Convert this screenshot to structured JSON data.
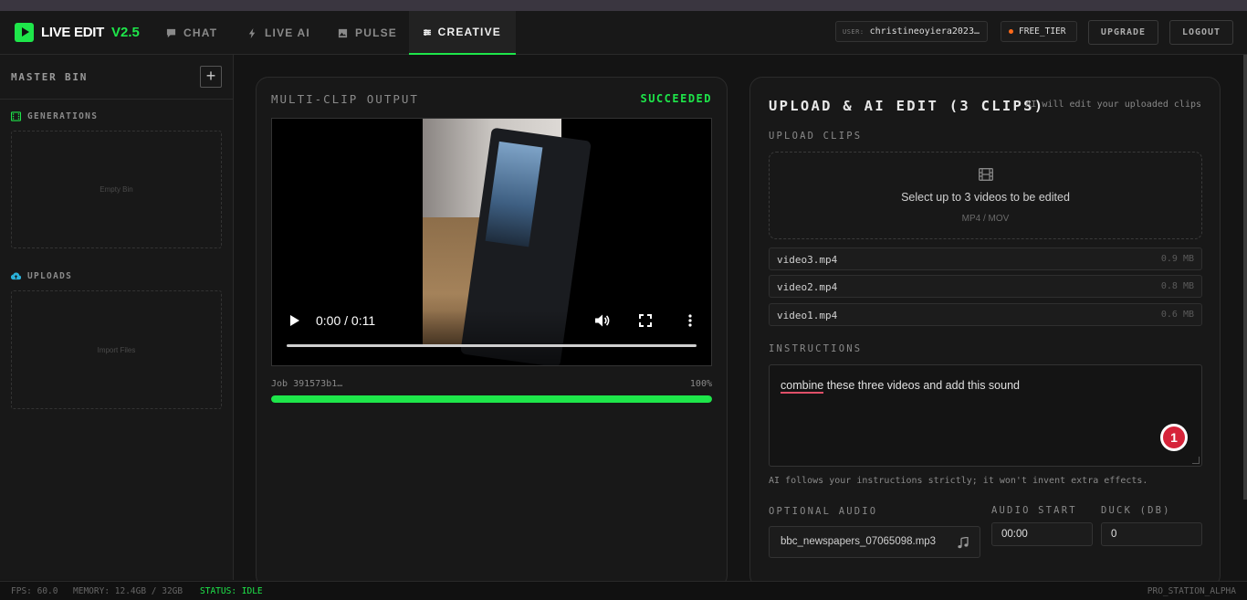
{
  "app": {
    "name": "LIVE EDIT",
    "version": "V2.5"
  },
  "nav": {
    "tabs": [
      {
        "label": "CHAT",
        "icon": "chat-icon"
      },
      {
        "label": "LIVE AI",
        "icon": "bolt-icon"
      },
      {
        "label": "PULSE",
        "icon": "image-icon"
      },
      {
        "label": "CREATIVE",
        "icon": "sliders-icon",
        "active": true
      }
    ],
    "user_label": "USER:",
    "user_value": "christineoyiera2023…",
    "tier": "FREE_TIER",
    "upgrade": "UPGRADE",
    "logout": "LOGOUT",
    "accent": "#1ee64a",
    "tier_dot": "#ff6a1a"
  },
  "sidebar": {
    "title": "MASTER BIN",
    "add": "+",
    "sections": [
      {
        "label": "GENERATIONS",
        "icon": "film-icon",
        "empty": "Empty Bin"
      },
      {
        "label": "UPLOADS",
        "icon": "cloud-upload-icon",
        "empty": "Import Files"
      }
    ]
  },
  "output": {
    "title": "MULTI-CLIP OUTPUT",
    "status": "SUCCEEDED",
    "time": "0:00 / 0:11",
    "job": "Job 391573b1…",
    "percent": "100%",
    "progress": 1.0
  },
  "upload": {
    "title": "UPLOAD & AI EDIT (3 CLIPS)",
    "note": "AI will edit your uploaded clips",
    "upload_label": "UPLOAD CLIPS",
    "dropzone_main": "Select up to 3 videos to be edited",
    "dropzone_sub": "MP4 / MOV",
    "files": [
      {
        "name": "video3.mp4",
        "size": "0.9 MB"
      },
      {
        "name": "video2.mp4",
        "size": "0.8 MB"
      },
      {
        "name": "video1.mp4",
        "size": "0.6 MB"
      }
    ],
    "instructions_label": "INSTRUCTIONS",
    "instructions_first": "combine",
    "instructions_rest": " these three videos and add this sound",
    "badge": "1",
    "hint": "AI follows your instructions strictly; it won't invent extra effects.",
    "audio_label": "OPTIONAL AUDIO",
    "audio_file": "bbc_newspapers_07065098.mp3",
    "audio_start_label": "AUDIO START",
    "audio_start": "00:00",
    "duck_label": "DUCK (DB)",
    "duck": "0"
  },
  "footer": {
    "fps": "FPS: 60.0",
    "memory": "MEMORY: 12.4GB / 32GB",
    "status": "STATUS: IDLE",
    "station": "PRO_STATION_ALPHA"
  }
}
